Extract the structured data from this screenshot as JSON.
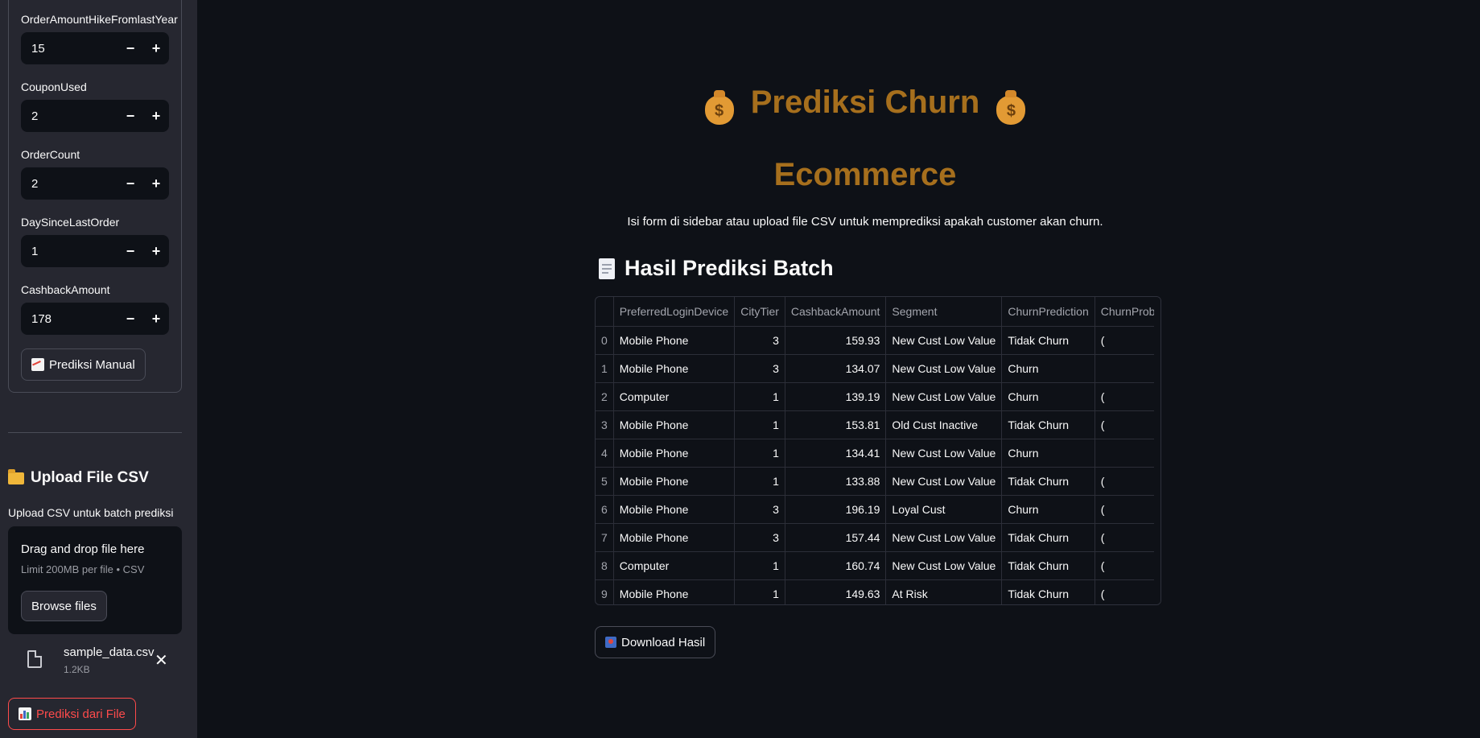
{
  "sidebar": {
    "fields": [
      {
        "label": "OrderAmountHikeFromlastYear",
        "value": "15"
      },
      {
        "label": "CouponUsed",
        "value": "2"
      },
      {
        "label": "OrderCount",
        "value": "2"
      },
      {
        "label": "DaySinceLastOrder",
        "value": "1"
      },
      {
        "label": "CashbackAmount",
        "value": "178"
      }
    ],
    "minus": "−",
    "plus": "+",
    "manual_button": "Prediksi Manual",
    "upload_heading": "Upload File CSV",
    "upload_help": "Upload CSV untuk batch prediksi",
    "dropzone": {
      "title": "Drag and drop file here",
      "limit": "Limit 200MB per file • CSV",
      "browse": "Browse files"
    },
    "file": {
      "name": "sample_data.csv",
      "size": "1.2KB"
    },
    "file_button": "Prediksi dari File"
  },
  "main": {
    "title_line1": "Prediksi Churn",
    "title_line2": "Ecommerce",
    "bag_glyph": "$",
    "subtitle": "Isi form di sidebar atau upload file CSV untuk memprediksi apakah customer akan churn.",
    "section_heading": "Hasil Prediksi Batch",
    "download_button": "Download Hasil"
  },
  "table": {
    "columns": [
      "",
      "PreferredLoginDevice",
      "CityTier",
      "CashbackAmount",
      "Segment",
      "ChurnPrediction",
      "ChurnProb"
    ],
    "rows": [
      [
        "0",
        "Mobile Phone",
        "3",
        "159.93",
        "New Cust Low Value",
        "Tidak Churn",
        "("
      ],
      [
        "1",
        "Mobile Phone",
        "3",
        "134.07",
        "New Cust Low Value",
        "Churn",
        ""
      ],
      [
        "2",
        "Computer",
        "1",
        "139.19",
        "New Cust Low Value",
        "Churn",
        "("
      ],
      [
        "3",
        "Mobile Phone",
        "1",
        "153.81",
        "Old Cust Inactive",
        "Tidak Churn",
        "("
      ],
      [
        "4",
        "Mobile Phone",
        "1",
        "134.41",
        "New Cust Low Value",
        "Churn",
        ""
      ],
      [
        "5",
        "Mobile Phone",
        "1",
        "133.88",
        "New Cust Low Value",
        "Tidak Churn",
        "("
      ],
      [
        "6",
        "Mobile Phone",
        "3",
        "196.19",
        "Loyal Cust",
        "Churn",
        "("
      ],
      [
        "7",
        "Mobile Phone",
        "3",
        "157.44",
        "New Cust Low Value",
        "Tidak Churn",
        "("
      ],
      [
        "8",
        "Computer",
        "1",
        "160.74",
        "New Cust Low Value",
        "Tidak Churn",
        "("
      ],
      [
        "9",
        "Mobile Phone",
        "1",
        "149.63",
        "At Risk",
        "Tidak Churn",
        "("
      ]
    ]
  },
  "colors": {
    "background": "#0e1117",
    "sidebar": "#262730",
    "title": "#a66f1d",
    "accent_red": "#ff4b4b"
  }
}
